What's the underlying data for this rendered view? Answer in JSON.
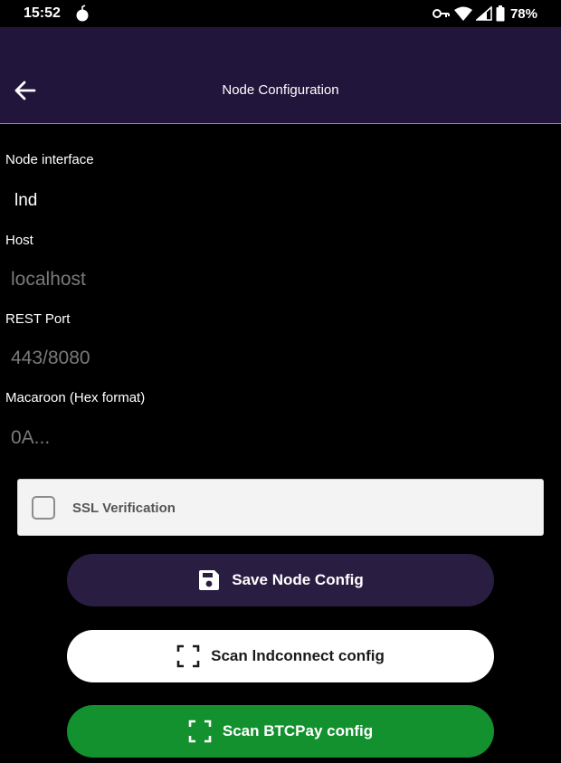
{
  "status_bar": {
    "time": "15:52",
    "app_icon": "bomb-icon",
    "icons": [
      "key-icon",
      "wifi-icon",
      "signal-icon",
      "battery-icon"
    ],
    "battery": "78%"
  },
  "toolbar": {
    "back_icon": "arrow-left-icon",
    "title": "Node Configuration",
    "background": "#21153b"
  },
  "form": {
    "node_interface": {
      "label": "Node interface",
      "value": "lnd"
    },
    "host": {
      "label": "Host",
      "placeholder": "localhost"
    },
    "rest_port": {
      "label": "REST Port",
      "placeholder": "443/8080"
    },
    "macaroon": {
      "label": "Macaroon (Hex format)",
      "placeholder": "0A..."
    },
    "ssl": {
      "label": "SSL Verification",
      "checked": false
    }
  },
  "buttons": {
    "save": {
      "label": "Save Node Config",
      "icon": "save-icon",
      "color": "#2a1d42"
    },
    "scan_lnd": {
      "label": "Scan lndconnect config",
      "icon": "scan-icon",
      "color": "#ffffff"
    },
    "scan_btcpay": {
      "label": "Scan BTCPay config",
      "icon": "scan-icon",
      "color": "#12912e"
    }
  }
}
